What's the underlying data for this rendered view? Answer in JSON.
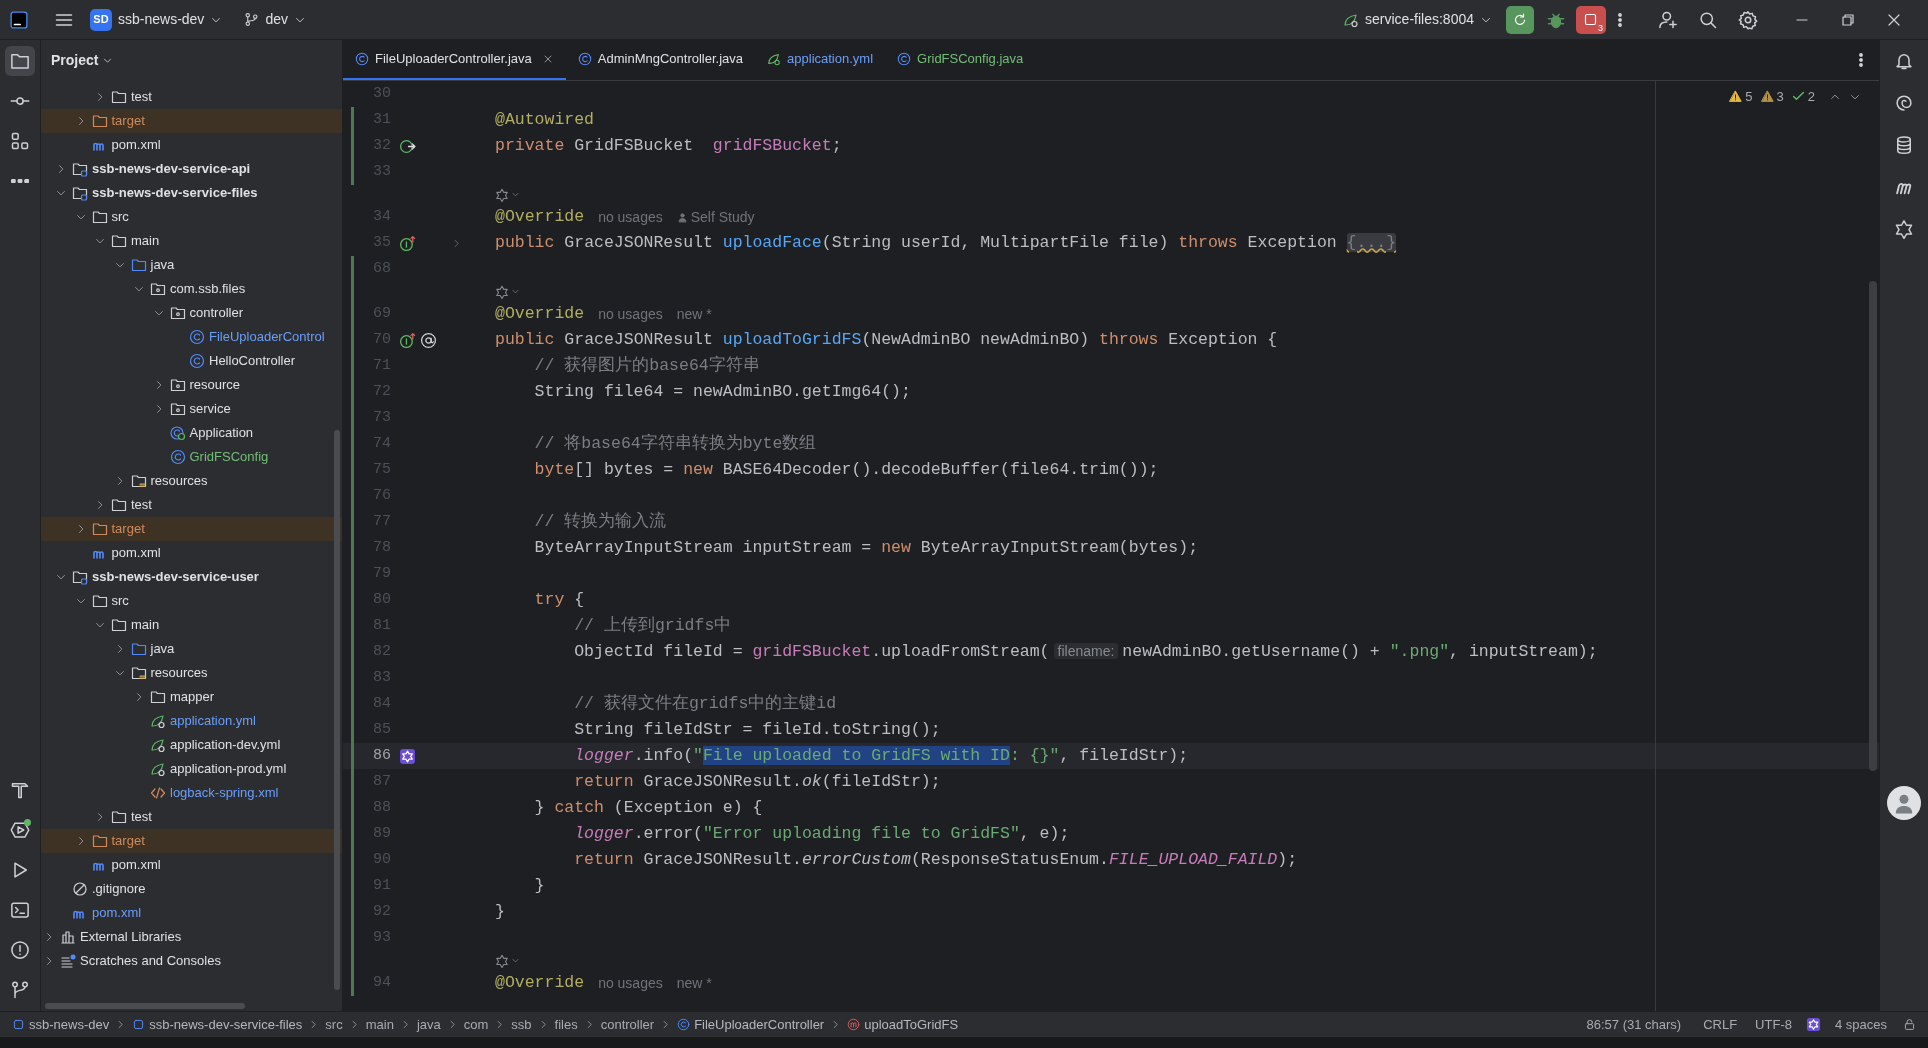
{
  "title_bar": {
    "project_badge": "SD",
    "project": "ssb-news-dev",
    "branch": "dev",
    "run_config": "service-files:8004",
    "stop_count": "3",
    "icons": [
      {
        "kind": "add-user"
      },
      {
        "kind": "search"
      },
      {
        "kind": "settings"
      }
    ]
  },
  "left_toolbar": {
    "top": [
      {
        "kind": "project",
        "selected": true,
        "dot": false
      },
      {
        "kind": "commit",
        "selected": false,
        "dot": false
      },
      {
        "kind": "structure",
        "selected": false,
        "dot": false
      },
      {
        "kind": "more",
        "selected": false,
        "dot": false
      }
    ],
    "bottom": [
      {
        "kind": "build",
        "selected": false,
        "dot": false
      },
      {
        "kind": "services",
        "selected": false,
        "dot": true
      },
      {
        "kind": "run",
        "selected": false,
        "dot": false
      },
      {
        "kind": "terminal",
        "selected": false,
        "dot": false
      },
      {
        "kind": "problems",
        "selected": false,
        "dot": false
      },
      {
        "kind": "git",
        "selected": false,
        "dot": false
      }
    ]
  },
  "project_panel": {
    "title": "Project",
    "tree": [
      {
        "children": [
          {
            "children": [
              {
                "children": [
                  {
                    "label": "test",
                    "kind": "folder",
                    "expanded": false,
                    "modified": false,
                    "added": false
                  }
                ]
              },
              {
                "label": "target",
                "kind": "excluded-folder",
                "expanded": false,
                "modified": false,
                "added": false
              },
              {
                "label": "pom.xml",
                "kind": "maven",
                "modified": false,
                "added": false
              }
            ]
          },
          {
            "label": "ssb-news-dev-service-api",
            "kind": "module",
            "expanded": false,
            "modified": false,
            "added": false
          },
          {
            "label": "ssb-news-dev-service-files",
            "kind": "module",
            "expanded": true,
            "modified": false,
            "added": false,
            "children": [
              {
                "label": "src",
                "kind": "folder",
                "expanded": true,
                "modified": false,
                "added": false,
                "children": [
                  {
                    "label": "main",
                    "kind": "folder",
                    "expanded": true,
                    "modified": false,
                    "added": false,
                    "children": [
                      {
                        "label": "java",
                        "kind": "source-folder",
                        "expanded": true,
                        "modified": false,
                        "added": false,
                        "children": [
                          {
                            "label": "com.ssb.files",
                            "kind": "package",
                            "expanded": true,
                            "modified": false,
                            "added": false,
                            "children": [
                              {
                                "label": "controller",
                                "kind": "package",
                                "expanded": true,
                                "modified": false,
                                "added": false,
                                "children": [
                                  {
                                    "label": "FileUploaderControl",
                                    "kind": "class",
                                    "modified": true,
                                    "added": false
                                  },
                                  {
                                    "label": "HelloController",
                                    "kind": "class",
                                    "modified": false,
                                    "added": false
                                  }
                                ]
                              },
                              {
                                "label": "resource",
                                "kind": "package",
                                "expanded": false,
                                "modified": false,
                                "added": false
                              },
                              {
                                "label": "service",
                                "kind": "package",
                                "expanded": false,
                                "modified": false,
                                "added": false
                              },
                              {
                                "label": "Application",
                                "kind": "app-class",
                                "modified": false,
                                "added": false
                              },
                              {
                                "label": "GridFSConfig",
                                "kind": "class",
                                "modified": false,
                                "added": true
                              }
                            ]
                          }
                        ]
                      },
                      {
                        "label": "resources",
                        "kind": "resources-folder",
                        "expanded": false,
                        "modified": false,
                        "added": false
                      }
                    ]
                  },
                  {
                    "label": "test",
                    "kind": "folder",
                    "expanded": false,
                    "modified": false,
                    "added": false
                  }
                ]
              },
              {
                "label": "target",
                "kind": "excluded-folder",
                "expanded": false,
                "modified": false,
                "added": false
              },
              {
                "label": "pom.xml",
                "kind": "maven",
                "modified": false,
                "added": false
              }
            ]
          },
          {
            "label": "ssb-news-dev-service-user",
            "kind": "module",
            "expanded": true,
            "modified": false,
            "added": false,
            "children": [
              {
                "label": "src",
                "kind": "folder",
                "expanded": true,
                "modified": false,
                "added": false,
                "children": [
                  {
                    "label": "main",
                    "kind": "folder",
                    "expanded": true,
                    "modified": false,
                    "added": false,
                    "children": [
                      {
                        "label": "java",
                        "kind": "source-folder",
                        "expanded": false,
                        "modified": false,
                        "added": false
                      },
                      {
                        "label": "resources",
                        "kind": "resources-folder",
                        "expanded": true,
                        "modified": false,
                        "added": false,
                        "children": [
                          {
                            "label": "mapper",
                            "kind": "folder",
                            "expanded": false,
                            "modified": false,
                            "added": false
                          },
                          {
                            "label": "application.yml",
                            "kind": "spring-yml",
                            "modified": true,
                            "added": false
                          },
                          {
                            "label": "application-dev.yml",
                            "kind": "spring-yml",
                            "modified": false,
                            "added": false
                          },
                          {
                            "label": "application-prod.yml",
                            "kind": "spring-yml",
                            "modified": false,
                            "added": false
                          },
                          {
                            "label": "logback-spring.xml",
                            "kind": "xml",
                            "modified": true,
                            "added": false
                          }
                        ]
                      }
                    ]
                  },
                  {
                    "label": "test",
                    "kind": "folder",
                    "expanded": false,
                    "modified": false,
                    "added": false
                  }
                ]
              },
              {
                "label": "target",
                "kind": "excluded-folder",
                "expanded": false,
                "modified": false,
                "added": false
              },
              {
                "label": "pom.xml",
                "kind": "maven",
                "modified": false,
                "added": false
              }
            ]
          },
          {
            "label": ".gitignore",
            "kind": "ignore",
            "modified": false,
            "added": false
          },
          {
            "label": "pom.xml",
            "kind": "maven",
            "modified": true,
            "added": false
          }
        ]
      },
      {
        "label": "External Libraries",
        "kind": "libraries",
        "expanded": false,
        "modified": false,
        "added": false
      },
      {
        "label": "Scratches and Consoles",
        "kind": "scratches",
        "expanded": false,
        "modified": false,
        "added": false
      }
    ]
  },
  "tabs": [
    {
      "label": "FileUploaderController.java",
      "kind": "class",
      "selected": true,
      "modified": false,
      "added": false
    },
    {
      "label": "AdminMngController.java",
      "kind": "class",
      "selected": false,
      "modified": false,
      "added": false
    },
    {
      "label": "application.yml",
      "kind": "spring-yml",
      "selected": false,
      "modified": true,
      "added": false
    },
    {
      "label": "GridFSConfig.java",
      "kind": "class",
      "selected": false,
      "modified": false,
      "added": true
    }
  ],
  "problems": {
    "warnings": "5",
    "weak_warnings": "3",
    "typos": "2"
  },
  "editor": {
    "lines": [
      {
        "kind": "code",
        "number": "30",
        "changed": false,
        "current": false
      },
      {
        "kind": "code",
        "number": "31",
        "changed": true,
        "current": false,
        "tokens": [
          {
            "text": "@Autowired",
            "kind": "annotation"
          }
        ]
      },
      {
        "kind": "code",
        "number": "32",
        "changed": true,
        "current": false,
        "gutter": [
          {
            "kind": "bean"
          }
        ],
        "tokens": [
          {
            "text": "private",
            "kind": "keyword"
          },
          {
            "text": " GridFSBucket  ",
            "kind": "plain"
          },
          {
            "text": "gridFSBucket",
            "kind": "field"
          },
          {
            "text": ";",
            "kind": "plain"
          }
        ]
      },
      {
        "kind": "code",
        "number": "33",
        "changed": true,
        "current": false
      },
      {
        "kind": "inlay",
        "changed": false
      },
      {
        "kind": "code",
        "number": "34",
        "changed": false,
        "current": false,
        "tokens": [
          {
            "text": "@Override",
            "kind": "annotation"
          },
          {
            "text": "no usages",
            "kind": "hint"
          },
          {
            "text": "Self Study",
            "kind": "author"
          }
        ]
      },
      {
        "kind": "code",
        "number": "35",
        "changed": false,
        "current": false,
        "gutter": [
          {
            "kind": "implements"
          },
          {
            "kind": "fold"
          }
        ],
        "tokens": [
          {
            "text": "public",
            "kind": "keyword"
          },
          {
            "text": " GraceJSONResult ",
            "kind": "plain"
          },
          {
            "text": "uploadFace",
            "kind": "method"
          },
          {
            "text": "(String userId, MultipartFile file) ",
            "kind": "plain"
          },
          {
            "text": "throws",
            "kind": "keyword"
          },
          {
            "text": " Exception ",
            "kind": "plain"
          },
          {
            "text": "{...}",
            "kind": "folded"
          }
        ]
      },
      {
        "kind": "code",
        "number": "68",
        "changed": true,
        "current": false
      },
      {
        "kind": "inlay",
        "changed": true
      },
      {
        "kind": "code",
        "number": "69",
        "changed": true,
        "current": false,
        "tokens": [
          {
            "text": "@Override",
            "kind": "annotation"
          },
          {
            "text": "no usages",
            "kind": "hint"
          },
          {
            "text": "new *",
            "kind": "hint"
          }
        ]
      },
      {
        "kind": "code",
        "number": "70",
        "changed": true,
        "current": false,
        "gutter": [
          {
            "kind": "implements"
          },
          {
            "kind": "at"
          }
        ],
        "tokens": [
          {
            "text": "public",
            "kind": "keyword"
          },
          {
            "text": " GraceJSONResult ",
            "kind": "plain"
          },
          {
            "text": "uploadToGridFS",
            "kind": "method"
          },
          {
            "text": "(NewAdminBO newAdminBO) ",
            "kind": "plain"
          },
          {
            "text": "throws",
            "kind": "keyword"
          },
          {
            "text": " Exception {",
            "kind": "plain"
          }
        ]
      },
      {
        "kind": "code",
        "number": "71",
        "changed": true,
        "current": false,
        "tokens": [
          {
            "text": "    // 获得图片的base64字符串",
            "kind": "comment"
          }
        ]
      },
      {
        "kind": "code",
        "number": "72",
        "changed": true,
        "current": false,
        "tokens": [
          {
            "text": "    String file64 = newAdminBO.getImg64();",
            "kind": "plain"
          }
        ]
      },
      {
        "kind": "code",
        "number": "73",
        "changed": true,
        "current": false
      },
      {
        "kind": "code",
        "number": "74",
        "changed": true,
        "current": false,
        "tokens": [
          {
            "text": "    // 将base64字符串转换为byte数组",
            "kind": "comment"
          }
        ]
      },
      {
        "kind": "code",
        "number": "75",
        "changed": true,
        "current": false,
        "tokens": [
          {
            "text": "    byte",
            "kind": "keyword"
          },
          {
            "text": "[] bytes = ",
            "kind": "plain"
          },
          {
            "text": "new",
            "kind": "keyword"
          },
          {
            "text": " BASE64Decoder().decodeBuffer(file64.trim());",
            "kind": "plain"
          }
        ]
      },
      {
        "kind": "code",
        "number": "76",
        "changed": true,
        "current": false
      },
      {
        "kind": "code",
        "number": "77",
        "changed": true,
        "current": false,
        "tokens": [
          {
            "text": "    // 转换为输入流",
            "kind": "comment"
          }
        ]
      },
      {
        "kind": "code",
        "number": "78",
        "changed": true,
        "current": false,
        "tokens": [
          {
            "text": "    ByteArrayInputStream inputStream = ",
            "kind": "plain"
          },
          {
            "text": "new",
            "kind": "keyword"
          },
          {
            "text": " ByteArrayInputStream(bytes);",
            "kind": "plain"
          }
        ]
      },
      {
        "kind": "code",
        "number": "79",
        "changed": true,
        "current": false
      },
      {
        "kind": "code",
        "number": "80",
        "changed": true,
        "current": false,
        "tokens": [
          {
            "text": "    try",
            "kind": "keyword"
          },
          {
            "text": " {",
            "kind": "plain"
          }
        ]
      },
      {
        "kind": "code",
        "number": "81",
        "changed": true,
        "current": false,
        "tokens": [
          {
            "text": "        // 上传到gridfs中",
            "kind": "comment"
          }
        ]
      },
      {
        "kind": "code",
        "number": "82",
        "changed": true,
        "current": false,
        "tokens": [
          {
            "text": "        ObjectId fileId = ",
            "kind": "plain"
          },
          {
            "text": "gridFSBucket",
            "kind": "field"
          },
          {
            "text": ".uploadFromStream(",
            "kind": "plain"
          },
          {
            "text": "filename:",
            "kind": "param-hint"
          },
          {
            "text": "newAdminBO.getUsername() + ",
            "kind": "plain"
          },
          {
            "text": "\".png\"",
            "kind": "string"
          },
          {
            "text": ", inputStream);",
            "kind": "plain"
          }
        ]
      },
      {
        "kind": "code",
        "number": "83",
        "changed": true,
        "current": false
      },
      {
        "kind": "code",
        "number": "84",
        "changed": true,
        "current": false,
        "tokens": [
          {
            "text": "        // 获得文件在gridfs中的主键id",
            "kind": "comment"
          }
        ]
      },
      {
        "kind": "code",
        "number": "85",
        "changed": true,
        "current": false,
        "tokens": [
          {
            "text": "        String fileIdStr = fileId.toString();",
            "kind": "plain"
          }
        ]
      },
      {
        "kind": "code",
        "number": "86",
        "changed": true,
        "current": true,
        "gutter": [
          {
            "kind": "ai"
          }
        ],
        "tokens": [
          {
            "text": "        logger",
            "kind": "static-field"
          },
          {
            "text": ".info(",
            "kind": "plain"
          },
          {
            "text": "\"",
            "kind": "string"
          },
          {
            "text": "File uploaded to GridFS with ID",
            "kind": "selected-string"
          },
          {
            "text": ": {}\"",
            "kind": "string"
          },
          {
            "text": ", fileIdStr);",
            "kind": "plain"
          }
        ]
      },
      {
        "kind": "code",
        "number": "87",
        "changed": true,
        "current": false,
        "tokens": [
          {
            "text": "        return",
            "kind": "keyword"
          },
          {
            "text": " GraceJSONResult.",
            "kind": "plain"
          },
          {
            "text": "ok",
            "kind": "static-method"
          },
          {
            "text": "(fileIdStr);",
            "kind": "plain"
          }
        ]
      },
      {
        "kind": "code",
        "number": "88",
        "changed": true,
        "current": false,
        "tokens": [
          {
            "text": "    } ",
            "kind": "plain"
          },
          {
            "text": "catch",
            "kind": "keyword"
          },
          {
            "text": " (Exception e) {",
            "kind": "plain"
          }
        ]
      },
      {
        "kind": "code",
        "number": "89",
        "changed": true,
        "current": false,
        "tokens": [
          {
            "text": "        logger",
            "kind": "static-field"
          },
          {
            "text": ".error(",
            "kind": "plain"
          },
          {
            "text": "\"Error uploading file to GridFS\"",
            "kind": "string"
          },
          {
            "text": ", e);",
            "kind": "plain"
          }
        ]
      },
      {
        "kind": "code",
        "number": "90",
        "changed": true,
        "current": false,
        "tokens": [
          {
            "text": "        return",
            "kind": "keyword"
          },
          {
            "text": " GraceJSONResult.",
            "kind": "plain"
          },
          {
            "text": "errorCustom",
            "kind": "static-method"
          },
          {
            "text": "(ResponseStatusEnum.",
            "kind": "plain"
          },
          {
            "text": "FILE_UPLOAD_FAILD",
            "kind": "constant"
          },
          {
            "text": ");",
            "kind": "plain"
          }
        ]
      },
      {
        "kind": "code",
        "number": "91",
        "changed": true,
        "current": false,
        "tokens": [
          {
            "text": "    }",
            "kind": "plain"
          }
        ]
      },
      {
        "kind": "code",
        "number": "92",
        "changed": true,
        "current": false,
        "tokens": [
          {
            "text": "}",
            "kind": "plain"
          }
        ]
      },
      {
        "kind": "code",
        "number": "93",
        "changed": true,
        "current": false
      },
      {
        "kind": "inlay",
        "changed": true
      },
      {
        "kind": "code",
        "number": "94",
        "changed": true,
        "current": false,
        "tokens": [
          {
            "text": "@Override",
            "kind": "annotation"
          },
          {
            "text": "no usages",
            "kind": "hint"
          },
          {
            "text": "new *",
            "kind": "hint"
          }
        ]
      }
    ]
  },
  "right_toolbar": [
    {
      "kind": "notifications"
    },
    {
      "kind": "ai-chat"
    },
    {
      "kind": "database"
    },
    {
      "kind": "maven"
    },
    {
      "kind": "ai-assistant"
    }
  ],
  "status_bar": {
    "breadcrumbs": [
      {
        "label": "ssb-news-dev",
        "kind": "module"
      },
      {
        "label": "ssb-news-dev-service-files",
        "kind": "module"
      },
      {
        "label": "src",
        "kind": "folder"
      },
      {
        "label": "main",
        "kind": "folder"
      },
      {
        "label": "java",
        "kind": "folder"
      },
      {
        "label": "com",
        "kind": "folder"
      },
      {
        "label": "ssb",
        "kind": "folder"
      },
      {
        "label": "files",
        "kind": "folder"
      },
      {
        "label": "controller",
        "kind": "folder"
      },
      {
        "label": "FileUploaderController",
        "kind": "class"
      },
      {
        "label": "uploadToGridFS",
        "kind": "method"
      }
    ],
    "position": "86:57 (31 chars)",
    "line_separator": "CRLF",
    "encoding": "UTF-8",
    "indent": "4 spaces"
  }
}
